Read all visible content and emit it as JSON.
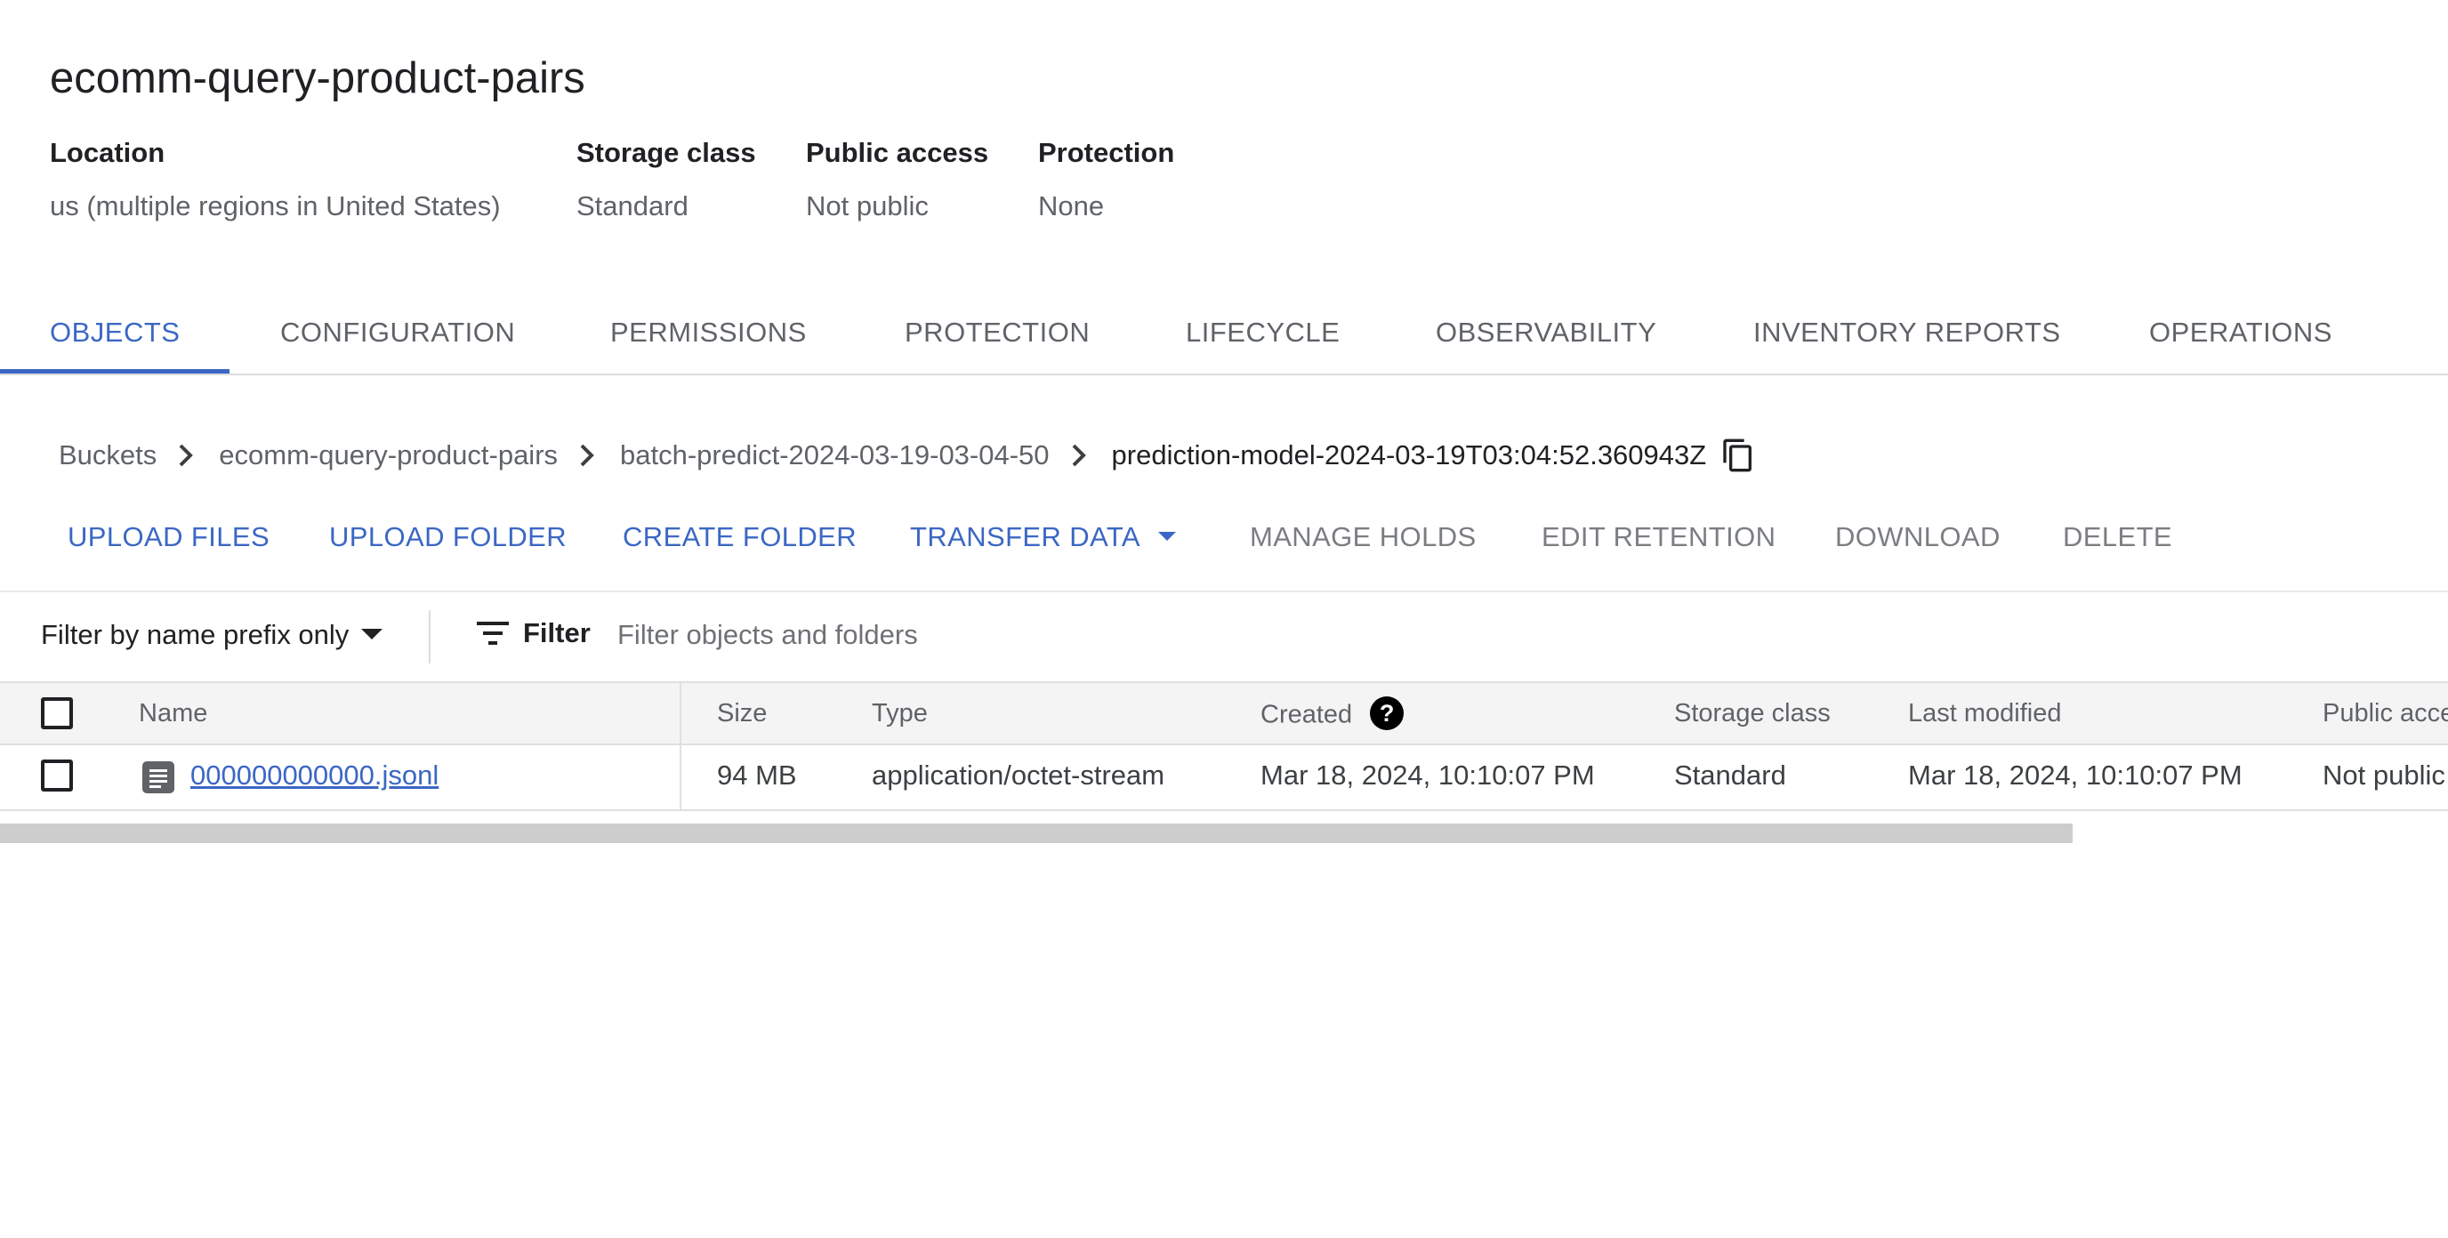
{
  "bucket": {
    "name": "ecomm-query-product-pairs",
    "location_label": "Location",
    "location_value": "us (multiple regions in United States)",
    "storage_class_label": "Storage class",
    "storage_class_value": "Standard",
    "public_access_label": "Public access",
    "public_access_value": "Not public",
    "protection_label": "Protection",
    "protection_value": "None"
  },
  "tabs": [
    {
      "label": "OBJECTS",
      "active": true
    },
    {
      "label": "CONFIGURATION"
    },
    {
      "label": "PERMISSIONS"
    },
    {
      "label": "PROTECTION"
    },
    {
      "label": "LIFECYCLE"
    },
    {
      "label": "OBSERVABILITY"
    },
    {
      "label": "INVENTORY REPORTS"
    },
    {
      "label": "OPERATIONS"
    }
  ],
  "breadcrumb": [
    "Buckets",
    "ecomm-query-product-pairs",
    "batch-predict-2024-03-19-03-04-50",
    "prediction-model-2024-03-19T03:04:52.360943Z"
  ],
  "actions": {
    "upload_files": "UPLOAD FILES",
    "upload_folder": "UPLOAD FOLDER",
    "create_folder": "CREATE FOLDER",
    "transfer_data": "TRANSFER DATA",
    "manage_holds": "MANAGE HOLDS",
    "edit_retention": "EDIT RETENTION",
    "download": "DOWNLOAD",
    "delete": "DELETE"
  },
  "filter": {
    "mode_label": "Filter by name prefix only",
    "button_label": "Filter",
    "placeholder": "Filter objects and folders"
  },
  "table": {
    "headers": {
      "name": "Name",
      "size": "Size",
      "type": "Type",
      "created": "Created",
      "storage_class": "Storage class",
      "last_modified": "Last modified",
      "public_access": "Public acce"
    },
    "rows": [
      {
        "name": "000000000000.jsonl",
        "size": "94 MB",
        "type": "application/octet-stream",
        "created": "Mar 18, 2024, 10:10:07 PM",
        "storage_class": "Standard",
        "last_modified": "Mar 18, 2024, 10:10:07 PM",
        "public_access": "Not public"
      }
    ]
  },
  "icons": {
    "chevron": "chevron-right-icon",
    "copy": "copy-icon",
    "filter": "filter-icon",
    "help": "help-icon",
    "file": "file-icon"
  },
  "colors": {
    "accent": "#3b67c4",
    "disabled_text": "#7a7d82",
    "header_bg": "#f4f4f4"
  }
}
